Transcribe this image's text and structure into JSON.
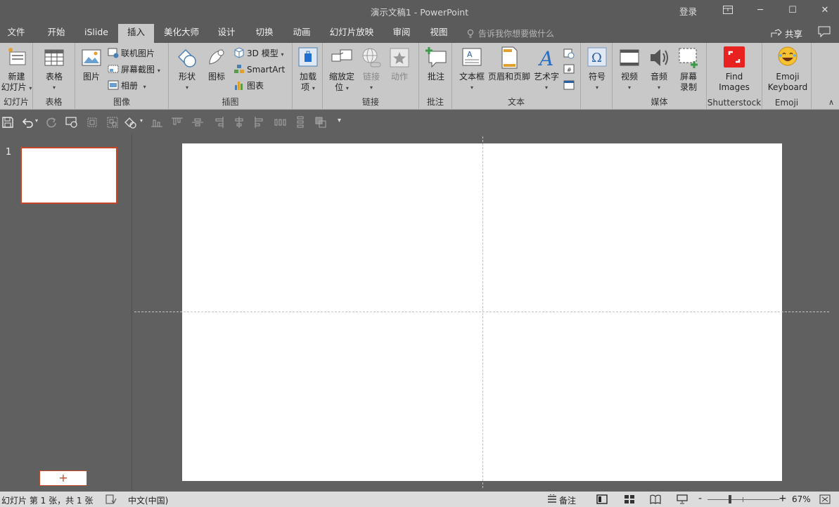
{
  "window": {
    "title": "演示文稿1  -  PowerPoint",
    "login": "登录",
    "ribbon_display_icon": "ribbon-display-options-icon",
    "minimize": "─",
    "maximize": "☐",
    "close": "✕"
  },
  "tabs": [
    "文件",
    "开始",
    "iSlide",
    "插入",
    "美化大师",
    "设计",
    "切换",
    "动画",
    "幻灯片放映",
    "审阅",
    "视图"
  ],
  "active_tab": "插入",
  "tell_me": {
    "placeholder": "告诉我你想要做什么"
  },
  "share": "共享",
  "ribbon": {
    "slides": {
      "label": "幻灯片",
      "new_slide_line1": "新建",
      "new_slide_line2": "幻灯片"
    },
    "tables": {
      "label": "表格",
      "table": "表格"
    },
    "images": {
      "label": "图像",
      "picture": "图片",
      "online_pictures": "联机图片",
      "screenshot": "屏幕截图",
      "album": "相册"
    },
    "illustrations": {
      "label": "插图",
      "shapes": "形状",
      "icons": "图标",
      "model3d": "3D 模型",
      "smartart": "SmartArt",
      "chart": "图表"
    },
    "addins": {
      "label": "",
      "addins_line1": "加载",
      "addins_line2": "项"
    },
    "links": {
      "label": "链接",
      "zoom_line1": "缩放定",
      "zoom_line2": "位",
      "link": "链接",
      "action": "动作"
    },
    "comments": {
      "label": "批注",
      "comment": "批注"
    },
    "text": {
      "label": "文本",
      "textbox": "文本框",
      "header_footer": "页眉和页脚",
      "wordart": "艺术字"
    },
    "symbols": {
      "label": "",
      "symbol": "符号"
    },
    "media": {
      "label": "媒体",
      "video": "视频",
      "audio": "音频",
      "screen_rec_line1": "屏幕",
      "screen_rec_line2": "录制"
    },
    "shutterstock": {
      "label": "Shutterstock",
      "find_line1": "Find",
      "find_line2": "Images"
    },
    "emoji": {
      "label": "Emoji",
      "btn_line1": "Emoji",
      "btn_line2": "Keyboard"
    },
    "collapse": "∧"
  },
  "slide_pane": {
    "slide_number": "1",
    "add_slide": "+"
  },
  "status": {
    "slide_info": "幻灯片 第 1 张，共 1 张",
    "language": "中文(中国)",
    "notes": "备注",
    "zoom_minus": "-",
    "zoom_plus": "+",
    "zoom_level": "67%",
    "zoom_fraction": 0.67
  },
  "colors": {
    "accent": "#c4472a",
    "ribbon_bg": "#c8c8c8",
    "titlebar_bg": "#5b5b5b",
    "workspace_bg": "#606060"
  }
}
